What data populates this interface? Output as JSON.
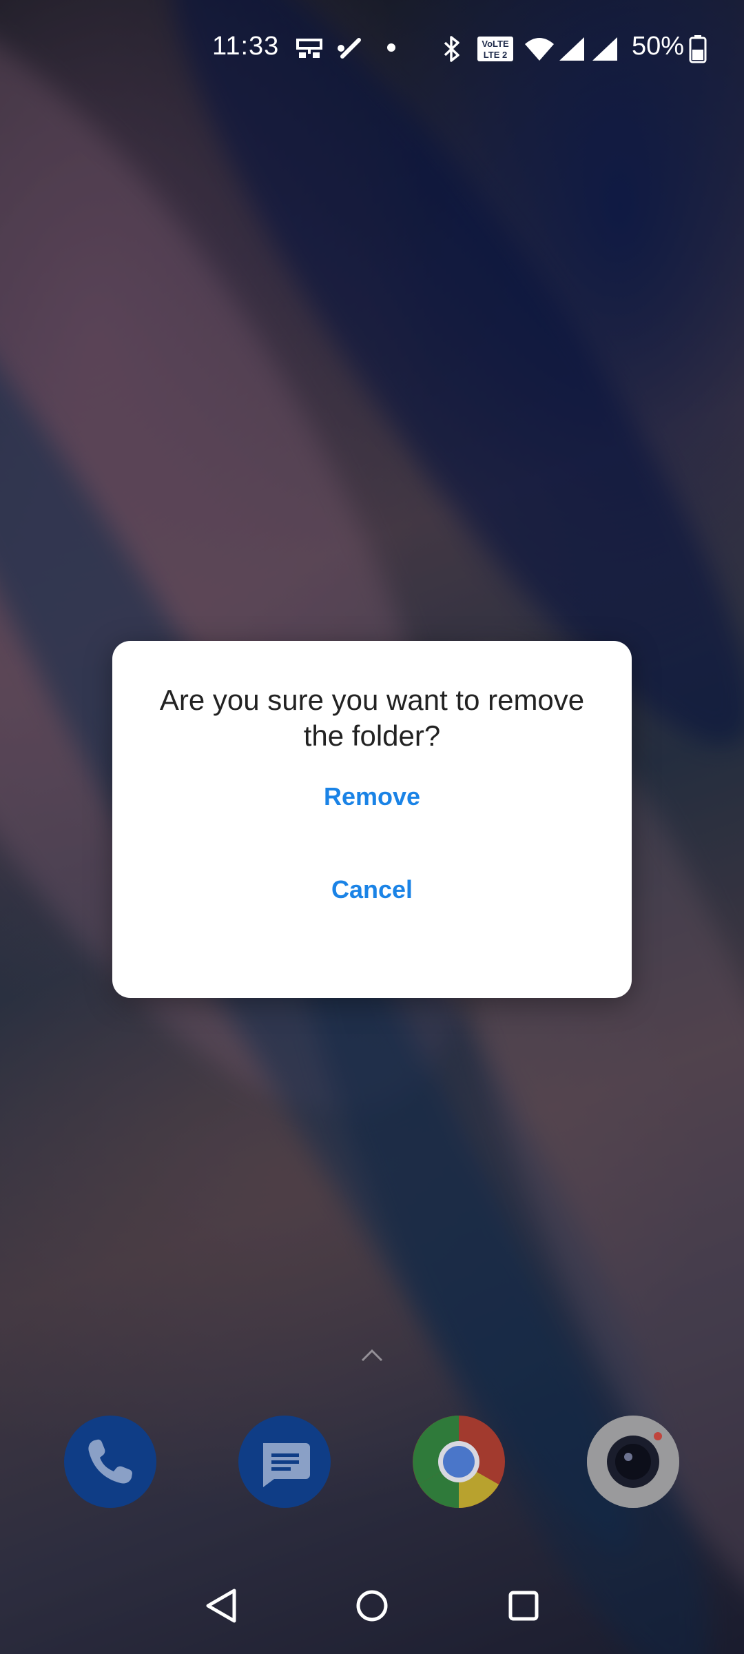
{
  "status_bar": {
    "time": "11:33",
    "battery_percent": "50%",
    "icons": [
      "network-icon",
      "tools-icon",
      "dot-icon",
      "bluetooth-icon",
      "volte-icon",
      "wifi-icon",
      "signal-icon",
      "signal-icon",
      "battery-icon"
    ]
  },
  "dialog": {
    "message": "Are you sure you want to remove the folder?",
    "remove_label": "Remove",
    "cancel_label": "Cancel",
    "button_color": "#1a83e6"
  },
  "dock": {
    "apps": [
      "phone",
      "messages",
      "chrome",
      "camera"
    ]
  },
  "nav": {
    "buttons": [
      "back",
      "home",
      "recents"
    ]
  }
}
